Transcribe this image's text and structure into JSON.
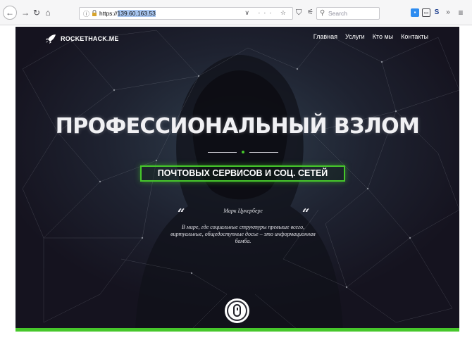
{
  "browser": {
    "url_scheme": "https://",
    "url_host": "139.60.163.53",
    "url_actions": "∨ ··· ☆",
    "search_placeholder": "Search"
  },
  "site": {
    "logo_text": "ROCKETHACK.ME",
    "nav": [
      "Главная",
      "Услуги",
      "Кто мы",
      "Контакты"
    ]
  },
  "hero": {
    "headline": "ПРОФЕССИОНАЛЬНЫЙ ВЗЛОМ",
    "cta_label": "ПОЧТОВЫХ СЕРВИСОВ И СОЦ. СЕТЕЙ",
    "quote_open": "“",
    "quote_close": "“",
    "quote_author": "Марк Цукерберг",
    "quote_text": "В мире, где социальные структуры превыше всего, виртуальные, общедоступные досье – это информационная бомба."
  },
  "icons": {
    "back": "arrow-left-icon",
    "forward": "arrow-right-icon",
    "reload": "reload-icon",
    "home": "home-icon",
    "logo": "rocket-icon",
    "scroll": "mouse-icon"
  },
  "colors": {
    "accent_green": "#46c72b",
    "page_bg": "#191627",
    "text_white": "#ffffff"
  }
}
